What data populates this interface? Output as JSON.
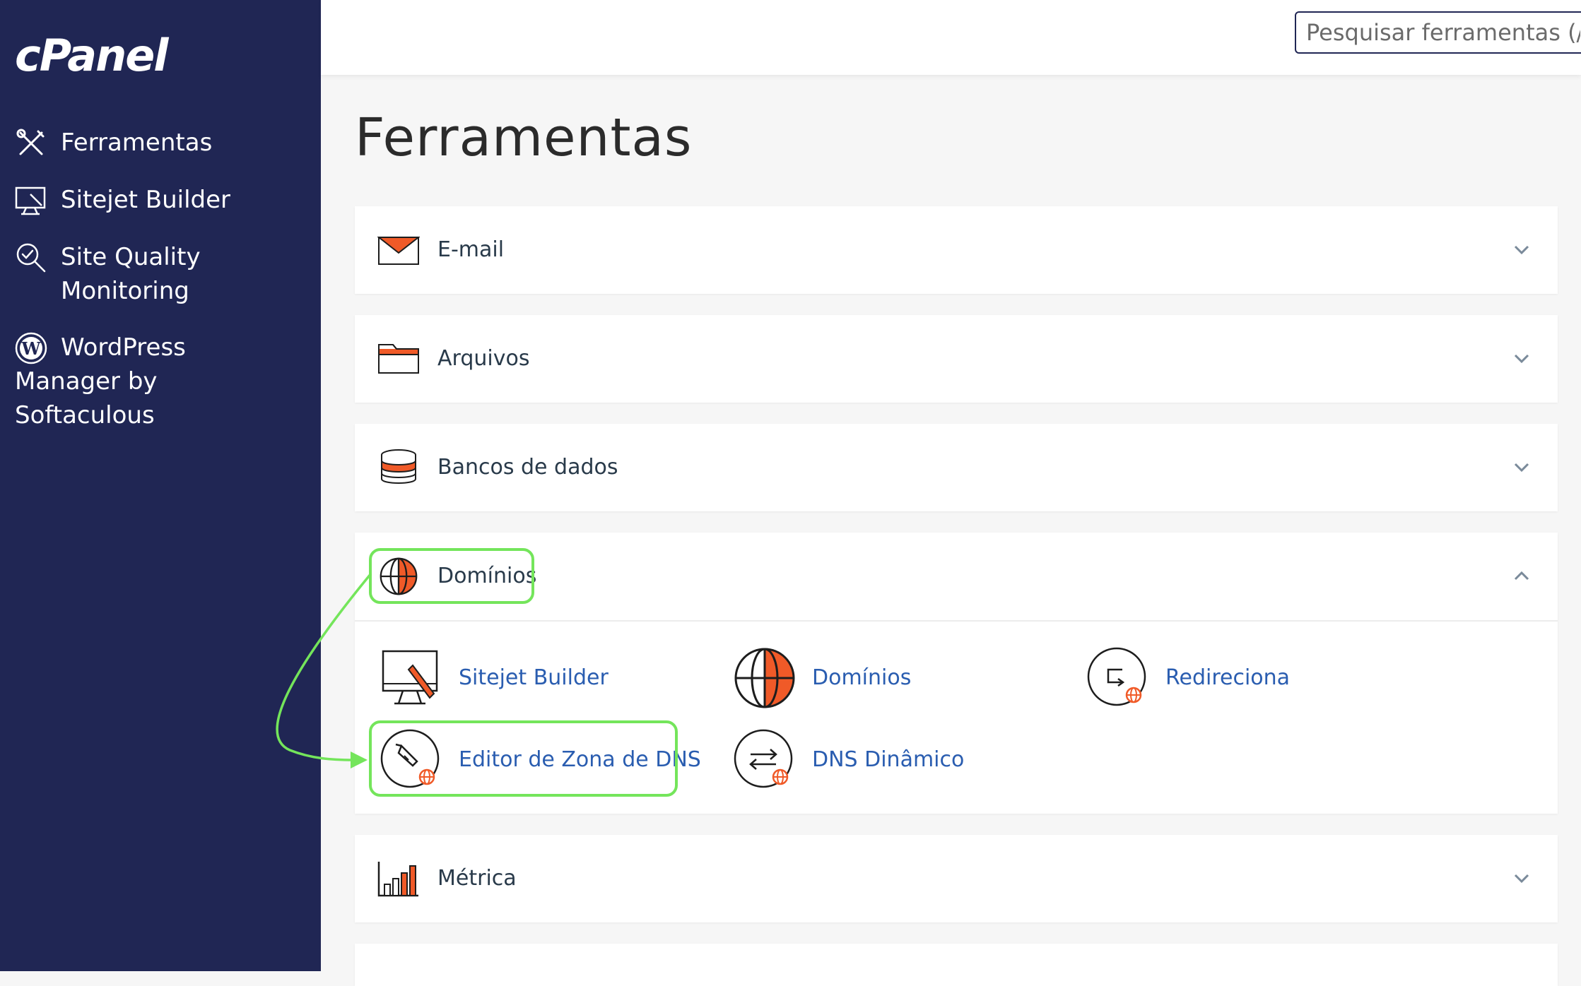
{
  "brand": {
    "logo_text": "cPanel"
  },
  "sidebar": {
    "items": [
      {
        "label": "Ferramentas",
        "icon": "tools-icon"
      },
      {
        "label": "Sitejet Builder",
        "icon": "monitor-pencil-icon"
      },
      {
        "label": "Site Quality Monitoring",
        "icon": "magnifier-check-icon"
      },
      {
        "label": "WordPress Manager by Softaculous",
        "icon": "wordpress-icon"
      }
    ]
  },
  "header": {
    "search_placeholder": "Pesquisar ferramentas (/)"
  },
  "main": {
    "title": "Ferramentas",
    "categories": [
      {
        "label": "E-mail",
        "icon": "envelope-icon",
        "expanded": false
      },
      {
        "label": "Arquivos",
        "icon": "folder-icon",
        "expanded": false
      },
      {
        "label": "Bancos de dados",
        "icon": "database-icon",
        "expanded": false
      },
      {
        "label": "Domínios",
        "icon": "globe-icon",
        "expanded": true,
        "tools": [
          {
            "label": "Sitejet Builder",
            "icon": "monitor-pencil-icon"
          },
          {
            "label": "Domínios",
            "icon": "globe-icon"
          },
          {
            "label": "Redireciona",
            "icon": "redirect-icon"
          },
          {
            "label": "Editor de Zona de DNS",
            "icon": "dns-zone-editor-icon"
          },
          {
            "label": "DNS Dinâmico",
            "icon": "dynamic-dns-icon"
          }
        ]
      },
      {
        "label": "Métrica",
        "icon": "bar-chart-icon",
        "expanded": false
      }
    ]
  },
  "colors": {
    "sidebar": "#202654",
    "accent_orange": "#f05a28",
    "link": "#2a5db0",
    "highlight": "#74e55b"
  }
}
